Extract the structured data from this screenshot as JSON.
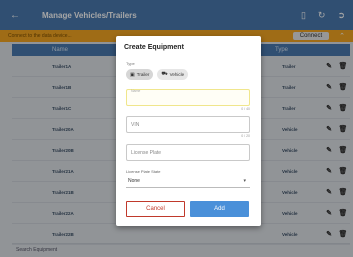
{
  "appbar": {
    "title": "Manage Vehicles/Trailers",
    "back_icon": "arrow-left-icon",
    "actions": [
      "tablet-icon",
      "refresh-icon",
      "exit-icon"
    ]
  },
  "notice": {
    "message": "Connect to the data device...",
    "connect_label": "Connect"
  },
  "table": {
    "headers": {
      "name": "Name",
      "type": "Type"
    },
    "rows": [
      {
        "name": "Trailer1A",
        "type": "Trailer"
      },
      {
        "name": "Trailer1B",
        "type": "Trailer"
      },
      {
        "name": "Trailer1C",
        "type": "Trailer"
      },
      {
        "name": "Trailer20A",
        "type": "Vehicle"
      },
      {
        "name": "Trailer20B",
        "type": "Vehicle"
      },
      {
        "name": "Trailer21A",
        "type": "Vehicle"
      },
      {
        "name": "Trailer21B",
        "type": "Vehicle"
      },
      {
        "name": "Trailer22A",
        "type": "Vehicle"
      },
      {
        "name": "Trailer22B",
        "type": "Vehicle"
      }
    ]
  },
  "search": {
    "placeholder": "Search Equipment"
  },
  "dialog": {
    "title": "Create Equipment",
    "type_label": "Type",
    "chips": [
      {
        "label": "Trailer",
        "icon": "trailer-icon",
        "selected": true
      },
      {
        "label": "Vehicle",
        "icon": "truck-icon",
        "selected": false
      }
    ],
    "name_field": {
      "label": "Name",
      "placeholder": "",
      "counter": "0 / 40"
    },
    "vin_field": {
      "placeholder": "VIN",
      "counter": "0 / 20"
    },
    "plate_field": {
      "placeholder": "License Plate"
    },
    "plate_state_label": "License Plate State",
    "plate_state_value": "None",
    "cancel_label": "Cancel",
    "add_label": "Add"
  }
}
